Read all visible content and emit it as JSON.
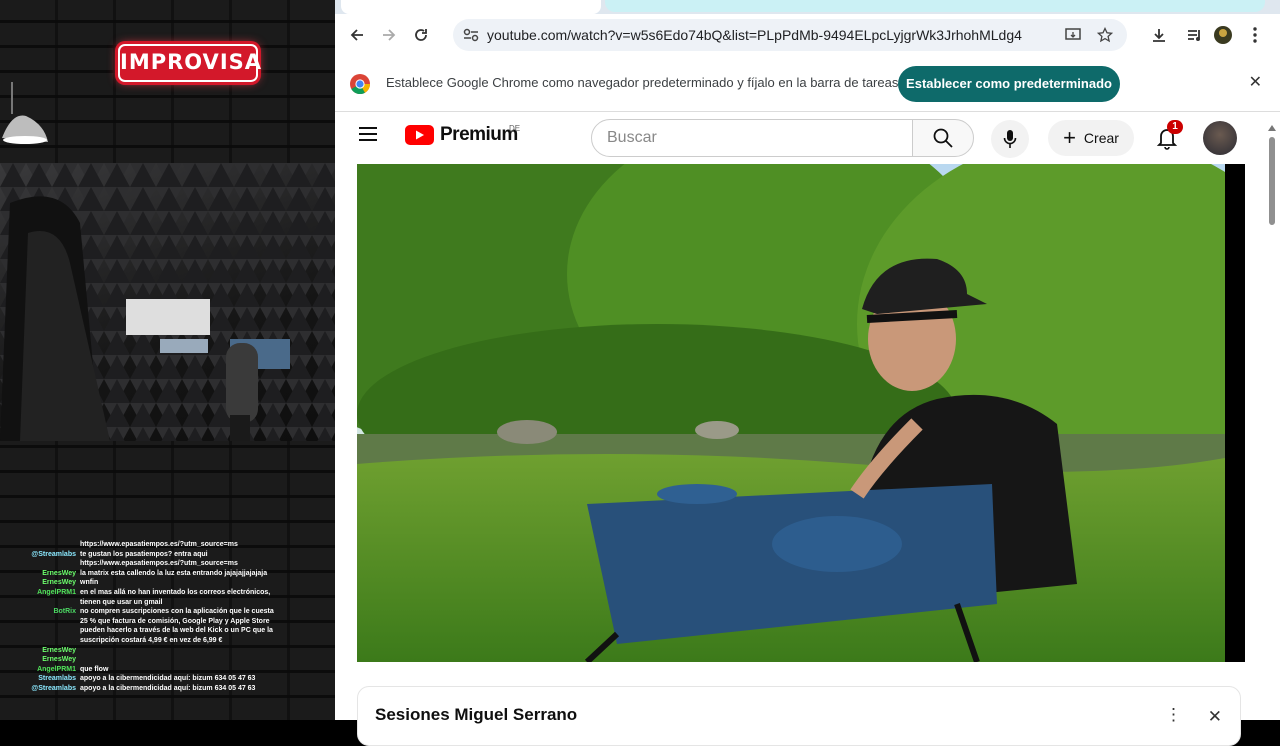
{
  "stream": {
    "logo": "IMPROVISA",
    "chat": [
      {
        "user": "",
        "text": "https://www.epasatiempos.es/?utm_source=ms",
        "color": "#ffffff"
      },
      {
        "user": "@Streamlabs",
        "text": "te gustan los pasatiempos? entra aqui",
        "color": "#8be9ff"
      },
      {
        "user": "",
        "text": "https://www.epasatiempos.es/?utm_source=ms",
        "color": "#ffffff"
      },
      {
        "user": "ErnesWey",
        "text": "la matrix esta callendo la luz esta entrando jajajajjajajaja",
        "color": "#6cff6c"
      },
      {
        "user": "ErnesWey",
        "text": "wnfin",
        "color": "#6cff6c"
      },
      {
        "user": "AngelPRM1",
        "text": "en el mas allá no han inventado los correos electrónicos, tienen que usar un gmail",
        "color": "#50e35a"
      },
      {
        "user": "BotRix",
        "text": "no compren suscripciones con la aplicación que le cuesta 25 % que factura de comisión, Google Play y Apple Store pueden hacerlo a través de la web del Kick o un PC que la suscripción costará 4,99 € en vez de 6,99 €",
        "color": "#4cd964"
      },
      {
        "user": "ErnesWey",
        "text": "",
        "color": "#6cff6c"
      },
      {
        "user": "ErnesWey",
        "text": "",
        "color": "#6cff6c"
      },
      {
        "user": "AngelPRM1",
        "text": "que flow",
        "color": "#50e35a"
      },
      {
        "user": "Streamlabs",
        "text": "apoyo a la cibermendicidad aquí: bizum 634 05 47 63",
        "color": "#8be9ff"
      },
      {
        "user": "@Streamlabs",
        "text": "apoyo a la cibermendicidad aquí: bizum 634 05 47 63",
        "color": "#8be9ff"
      }
    ]
  },
  "browser": {
    "url": "youtube.com/watch?v=w5s6Edo74bQ&list=PLpPdMb-9494ELpcLyjgrWk3JrhohMLdg4",
    "infobar_text": "Establece Google Chrome como navegador predeterminado y fíjalo en la barra de tareas",
    "infobar_button": "Establecer como predeterminado"
  },
  "youtube": {
    "logo_text": "Premium",
    "region": "DE",
    "search_placeholder": "Buscar",
    "create_label": "Crear",
    "notification_count": "1",
    "video_title": "Sesiones Miguel Serrano"
  },
  "colors": {
    "accent": "#0e6a6a",
    "yt_red": "#ff0000",
    "badge": "#cc0000"
  }
}
